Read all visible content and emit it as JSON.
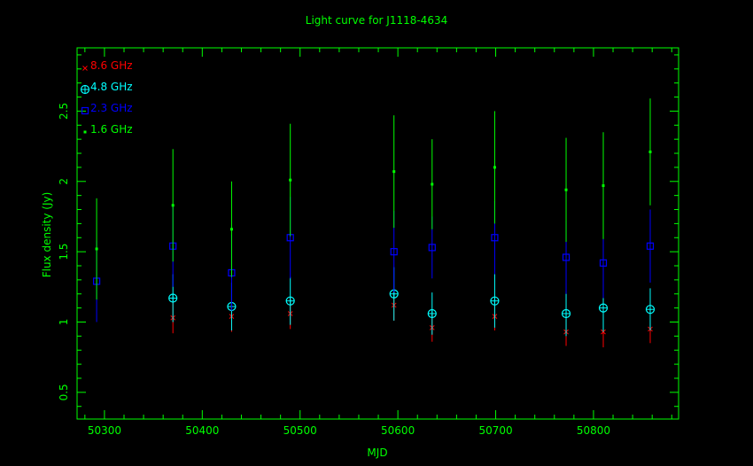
{
  "chart_data": {
    "type": "scatter",
    "title": "Light curve for J1118-4634",
    "xlabel": "MJD",
    "ylabel": "Flux density (Jy)",
    "xlim": [
      50272,
      50887
    ],
    "ylim": [
      0.31,
      2.95
    ],
    "xticks": [
      50300,
      50400,
      50500,
      50600,
      50700,
      50800
    ],
    "yticks": [
      0.5,
      1,
      1.5,
      2,
      2.5
    ],
    "grid": false,
    "legend_position": "top-left",
    "axis_color": "#00ff00",
    "series": [
      {
        "name": "8.6 GHz",
        "color": "#ff0000",
        "marker": "x",
        "points": [
          {
            "x": 50370,
            "y": 1.03,
            "err": 0.11
          },
          {
            "x": 50430,
            "y": 1.04,
            "err": 0.11
          },
          {
            "x": 50490,
            "y": 1.06,
            "err": 0.11
          },
          {
            "x": 50596,
            "y": 1.12,
            "err": 0.11
          },
          {
            "x": 50635,
            "y": 0.96,
            "err": 0.1
          },
          {
            "x": 50699,
            "y": 1.04,
            "err": 0.1
          },
          {
            "x": 50772,
            "y": 0.93,
            "err": 0.1
          },
          {
            "x": 50810,
            "y": 0.93,
            "err": 0.11
          },
          {
            "x": 50858,
            "y": 0.95,
            "err": 0.1
          }
        ]
      },
      {
        "name": "4.8 GHz",
        "color": "#00ffff",
        "marker": "circle-plus",
        "points": [
          {
            "x": 50370,
            "y": 1.17,
            "err": 0.17
          },
          {
            "x": 50430,
            "y": 1.11,
            "err": 0.17
          },
          {
            "x": 50490,
            "y": 1.15,
            "err": 0.17
          },
          {
            "x": 50596,
            "y": 1.2,
            "err": 0.19
          },
          {
            "x": 50635,
            "y": 1.06,
            "err": 0.15
          },
          {
            "x": 50699,
            "y": 1.15,
            "err": 0.19
          },
          {
            "x": 50772,
            "y": 1.06,
            "err": 0.16
          },
          {
            "x": 50810,
            "y": 1.1,
            "err": 0.17
          },
          {
            "x": 50858,
            "y": 1.09,
            "err": 0.15
          }
        ]
      },
      {
        "name": "2.3 GHz",
        "color": "#0000ff",
        "marker": "square",
        "points": [
          {
            "x": 50292,
            "y": 1.29,
            "err": 0.29
          },
          {
            "x": 50370,
            "y": 1.54,
            "err": 0.29
          },
          {
            "x": 50430,
            "y": 1.35,
            "err": 0.27
          },
          {
            "x": 50490,
            "y": 1.6,
            "err": 0.29
          },
          {
            "x": 50596,
            "y": 1.5,
            "err": 0.29
          },
          {
            "x": 50635,
            "y": 1.53,
            "err": 0.22
          },
          {
            "x": 50699,
            "y": 1.6,
            "err": 0.26
          },
          {
            "x": 50772,
            "y": 1.46,
            "err": 0.26
          },
          {
            "x": 50810,
            "y": 1.42,
            "err": 0.25
          },
          {
            "x": 50858,
            "y": 1.54,
            "err": 0.26
          }
        ]
      },
      {
        "name": "1.6 GHz",
        "color": "#00ff00",
        "marker": "dot",
        "points": [
          {
            "x": 50292,
            "y": 1.52,
            "err": 0.36
          },
          {
            "x": 50370,
            "y": 1.83,
            "err": 0.4
          },
          {
            "x": 50430,
            "y": 1.66,
            "err": 0.34
          },
          {
            "x": 50490,
            "y": 2.01,
            "err": 0.4
          },
          {
            "x": 50596,
            "y": 2.07,
            "err": 0.4
          },
          {
            "x": 50635,
            "y": 1.98,
            "err": 0.32
          },
          {
            "x": 50699,
            "y": 2.1,
            "err": 0.4
          },
          {
            "x": 50772,
            "y": 1.94,
            "err": 0.37
          },
          {
            "x": 50810,
            "y": 1.97,
            "err": 0.38
          },
          {
            "x": 50858,
            "y": 2.21,
            "err": 0.38
          }
        ]
      }
    ]
  }
}
